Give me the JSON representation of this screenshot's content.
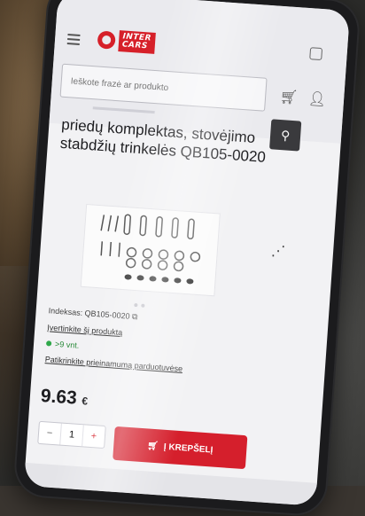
{
  "brand": {
    "line1": "INTER",
    "line2": "CARS"
  },
  "search": {
    "placeholder": "Ieškote frazė ar produkto"
  },
  "product": {
    "title": "priedų komplektas, stovėjimo stabdžių trinkelės QB105-0020",
    "index_label": "Indeksas: QB105-0020",
    "rate_link": "Įvertinkite šį produktą",
    "stock_text": ">9 vnt.",
    "availability_link": "Patikrinkite prieinamumą parduotuvėse",
    "price": "9.63",
    "currency": "€",
    "quantity": "1",
    "cart_button": "Į KREPŠELĮ"
  },
  "colors": {
    "accent": "#d51f2c",
    "stock": "#2fa84a"
  },
  "icons": [
    "menu-icon",
    "cart-icon",
    "user-icon",
    "search-icon",
    "share-icon",
    "copy-icon"
  ]
}
